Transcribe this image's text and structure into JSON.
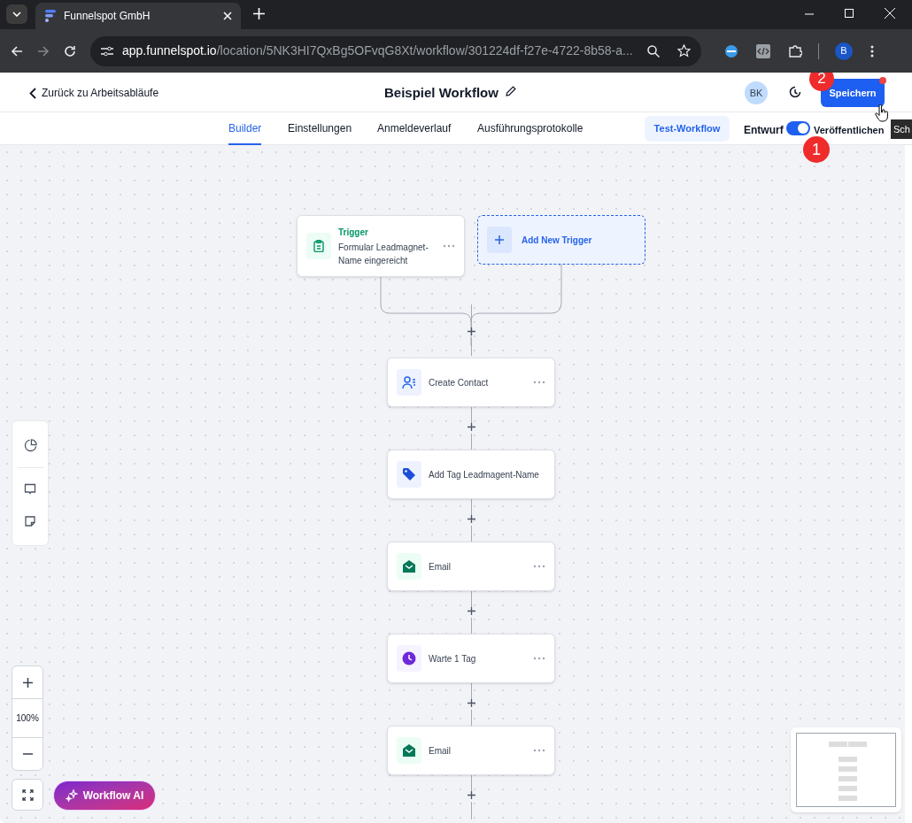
{
  "browser": {
    "tab_title": "Funnelspot GmbH",
    "url_host": "app.funnelspot.io",
    "url_path": "/location/5NK3HI7QxBg5OFvqG8Xt/workflow/301224df-f27e-4722-8b58-a...",
    "profile": "B"
  },
  "header": {
    "back_label": "Zurück zu Arbeitsabläufe",
    "title": "Beispiel Workflow",
    "avatar": "BK",
    "save_button": "Speichern"
  },
  "tabs": [
    {
      "label": "Builder",
      "selected": true
    },
    {
      "label": "Einstellungen",
      "selected": false
    },
    {
      "label": "Anmeldeverlauf",
      "selected": false
    },
    {
      "label": "Ausführungsprotokolle",
      "selected": false
    }
  ],
  "test_button": "Test-Workflow",
  "publish_toggle": {
    "off_label": "Entwurf",
    "on_label": "Veröffentlichen",
    "on": true
  },
  "tooltip": "Sch",
  "annotations": [
    "1",
    "2"
  ],
  "trigger": {
    "label": "Trigger",
    "text": "Formular Leadmagnet-Name eingereicht"
  },
  "add_trigger": "Add New Trigger",
  "steps": [
    {
      "kind": "contact",
      "label": "Create Contact"
    },
    {
      "kind": "tag",
      "label": "Add Tag Leadmagent-Name"
    },
    {
      "kind": "email",
      "label": "Email"
    },
    {
      "kind": "wait",
      "label": "Warte 1 Tag"
    },
    {
      "kind": "email",
      "label": "Email"
    }
  ],
  "zoom_level": "100%",
  "ai_button": "Workflow AI"
}
